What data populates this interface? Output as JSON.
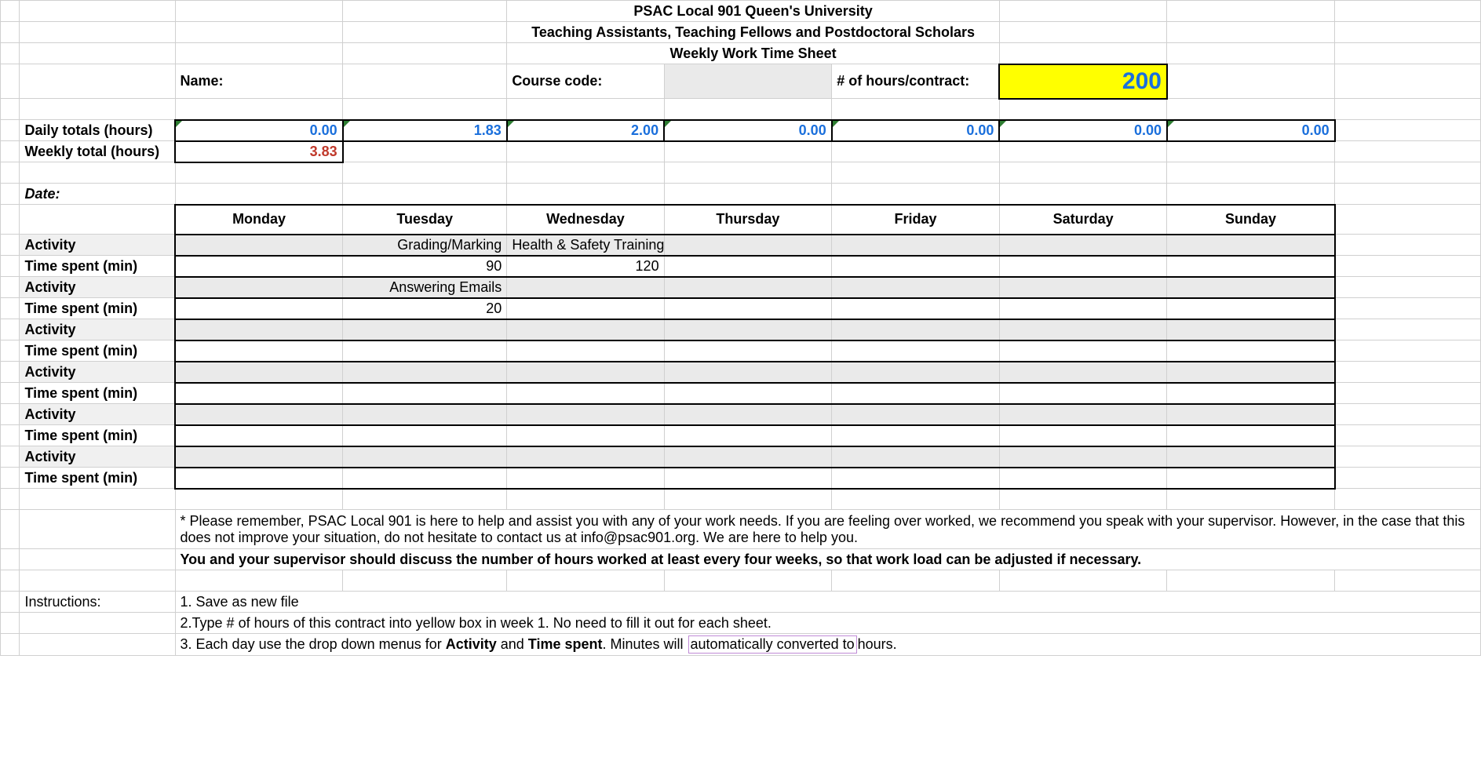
{
  "header": {
    "line1": "PSAC Local 901 Queen's University",
    "line2": "Teaching Assistants, Teaching Fellows and Postdoctoral Scholars",
    "line3": "Weekly Work Time Sheet"
  },
  "labels": {
    "name": "Name:",
    "course_code": "Course code:",
    "hours_contract": "# of hours/contract:",
    "daily_totals": "Daily totals (hours)",
    "weekly_total": "Weekly total (hours)",
    "date": "Date:",
    "activity": "Activity",
    "time_spent": "Time spent (min)",
    "instructions": "Instructions:"
  },
  "values": {
    "contract_hours": "200",
    "weekly_total": "3.83",
    "daily_totals": [
      "0.00",
      "1.83",
      "2.00",
      "0.00",
      "0.00",
      "0.00",
      "0.00"
    ]
  },
  "days": [
    "Monday",
    "Tuesday",
    "Wednesday",
    "Thursday",
    "Friday",
    "Saturday",
    "Sunday"
  ],
  "entries": {
    "slot1": {
      "activity": [
        "",
        "Grading/Marking",
        "Health & Safety Training",
        "",
        "",
        "",
        ""
      ],
      "time": [
        "",
        "90",
        "120",
        "",
        "",
        "",
        ""
      ]
    },
    "slot2": {
      "activity": [
        "",
        "Answering Emails",
        "",
        "",
        "",
        "",
        ""
      ],
      "time": [
        "",
        "20",
        "",
        "",
        "",
        "",
        ""
      ]
    },
    "slot3": {
      "activity": [
        "",
        "",
        "",
        "",
        "",
        "",
        ""
      ],
      "time": [
        "",
        "",
        "",
        "",
        "",
        "",
        ""
      ]
    },
    "slot4": {
      "activity": [
        "",
        "",
        "",
        "",
        "",
        "",
        ""
      ],
      "time": [
        "",
        "",
        "",
        "",
        "",
        "",
        ""
      ]
    },
    "slot5": {
      "activity": [
        "",
        "",
        "",
        "",
        "",
        "",
        ""
      ],
      "time": [
        "",
        "",
        "",
        "",
        "",
        "",
        ""
      ]
    },
    "slot6": {
      "activity": [
        "",
        "",
        "",
        "",
        "",
        "",
        ""
      ],
      "time": [
        "",
        "",
        "",
        "",
        "",
        "",
        ""
      ]
    }
  },
  "notes": {
    "reminder": "* Please remember, PSAC Local 901 is here to help and assist you with any of your work needs. If you are feeling over worked, we recommend you speak with your supervisor. However, in the case that this does not improve your situation, do not hesitate to contact us at info@psac901.org. We are here to help you.",
    "discuss": "You and your supervisor should discuss the number of hours worked at least every four weeks, so that work load can be adjusted if necessary.",
    "step1": "1. Save as new file",
    "step2": "2.Type # of hours of this contract into yellow box in week 1. No need to fill it out for each sheet.",
    "step3_pre": "3. Each day use the drop down menus for ",
    "step3_bold1": "Activity",
    "step3_mid": " and ",
    "step3_bold2": "Time spent",
    "step3_post1": ". Minutes will ",
    "step3_hl": "automatically converted to ",
    "step3_post2": "hours."
  }
}
